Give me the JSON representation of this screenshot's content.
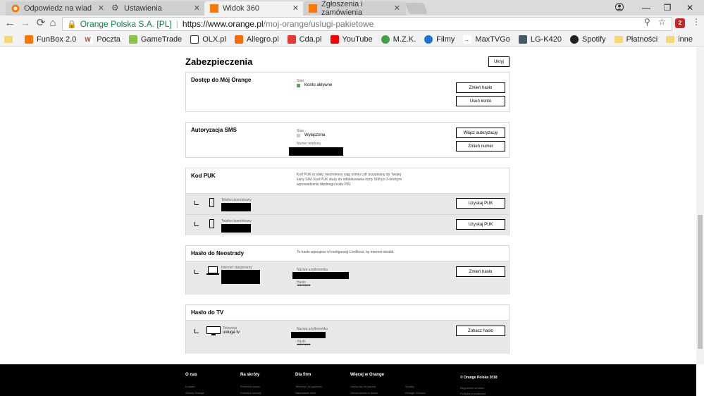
{
  "tabs": [
    {
      "title": "Odpowiedz na wiadomość"
    },
    {
      "title": "Ustawienia"
    },
    {
      "title": "Widok 360"
    },
    {
      "title": "Zgłoszenia i zamówienia"
    }
  ],
  "address_bar": {
    "origin_label": "Orange Polska S.A. [PL]",
    "url_host": "https://www.orange.pl",
    "url_path": "/moj-orange/uslugi-pakietowe"
  },
  "extension_badge": "2",
  "bookmarks": [
    {
      "label": ""
    },
    {
      "label": "FunBox 2.0"
    },
    {
      "label": "Poczta"
    },
    {
      "label": "GameTrade"
    },
    {
      "label": "OLX.pl"
    },
    {
      "label": "Allegro.pl"
    },
    {
      "label": "Cda.pl"
    },
    {
      "label": "YouTube"
    },
    {
      "label": "M.Z.K."
    },
    {
      "label": "Filmy"
    },
    {
      "label": "MaxTVGo"
    },
    {
      "label": "LG-K420"
    },
    {
      "label": "Spotify"
    },
    {
      "label": "Płatności"
    },
    {
      "label": "inne"
    }
  ],
  "page": {
    "section_title": "Zabezpieczenia",
    "hide_button": "Ukryj",
    "account": {
      "title": "Dostęp do Mój Orange",
      "status_label": "Stan",
      "status_value": "Konto aktywne",
      "change_password": "Zmień hasło",
      "delete_account": "Usuń konto"
    },
    "sms": {
      "title": "Autoryzacja SMS",
      "status_label": "Stan",
      "status_value": "Wyłączona",
      "phone_label": "Numer telefonu",
      "enable_button": "Włącz autoryzację",
      "change_number": "Zmień numer"
    },
    "puk": {
      "title": "Kod PUK",
      "description": "Kod PUK to stały, niezmienny ciąg ośmiu cyfr przypisany do Twojej karty SIM. Kod PUK służy do odblokowania karty SIM po 3-krotnym wprowadzeniu błędnego kodu PIN.",
      "rows": [
        {
          "device_label": "Telefon komórkowy",
          "button": "Uzyskaj PUK"
        },
        {
          "device_label": "Telefon komórkowy",
          "button": "Uzyskaj PUK"
        }
      ]
    },
    "neostrada": {
      "title": "Hasło do Neostrady",
      "description": "To hasło wpisujesz w konfiguracji LiveBoxa, by internet działał.",
      "device_label": "Internet stacjonarny",
      "user_label": "Nazwa użytkownika",
      "password_label": "Hasło",
      "password_mask": "••••••••••••",
      "button": "Zmień hasło"
    },
    "tv": {
      "title": "Hasło do TV",
      "device_label": "Telewizja",
      "device_value": "usługa tv",
      "user_label": "Nazwa użytkownika",
      "password_label": "Hasło",
      "password_mask": "••••••••••••",
      "button": "Zobacz hasło"
    }
  },
  "footer": {
    "columns": [
      {
        "title": "O nas",
        "links": [
          "Kontakt",
          "Salony Orange"
        ]
      },
      {
        "title": "Na skróty",
        "links": [
          "Przenieś numer",
          "Przedłuż umowę"
        ]
      },
      {
        "title": "Dla firm",
        "links": [
          "Telefony i urządzenia",
          "Nadawanie ofert"
        ]
      },
      {
        "title": "Więcej w Orange",
        "links": [
          "Umów się do salonu",
          "Umów serwis w domu"
        ]
      },
      {
        "title": "",
        "links": [
          "Spotify",
          "Orange Chmura"
        ]
      },
      {
        "title": "© Orange Polska 2018",
        "links": [
          "Regulamin serwisu",
          "Polityka prywatności"
        ]
      }
    ]
  },
  "colors": {
    "accent": "#ff7900",
    "status_active": "#4caf50"
  }
}
